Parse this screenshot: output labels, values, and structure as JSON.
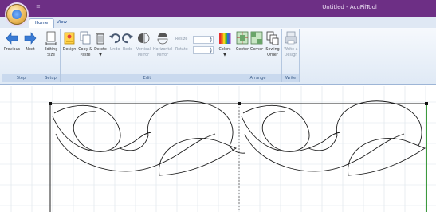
{
  "window": {
    "title": "Untitled - AcuFilTool"
  },
  "tabs": [
    {
      "label": "Home"
    },
    {
      "label": "View"
    }
  ],
  "ribbon": {
    "groups": [
      {
        "label": "Step"
      },
      {
        "label": "Setup"
      },
      {
        "label": "Edit"
      },
      {
        "label": "Arrange"
      },
      {
        "label": "Write"
      }
    ],
    "buttons": {
      "previous": [
        "Previous"
      ],
      "next": [
        "Next"
      ],
      "editing_size": [
        "Editing",
        "Size"
      ],
      "design": [
        "Design"
      ],
      "copy_paste": [
        "Copy &",
        "Paste"
      ],
      "delete": [
        "Delete",
        "▼"
      ],
      "undo": [
        "Undo"
      ],
      "redo": [
        "Redo"
      ],
      "vertical_mirror": [
        "Vertical",
        "Mirror"
      ],
      "horizontal_mirror": [
        "Horizontal",
        "Mirror"
      ],
      "colors": [
        "Colors",
        "▼"
      ],
      "center": [
        "Center"
      ],
      "corner": [
        "Corner"
      ],
      "sewing_order": [
        "Sewing",
        "Order"
      ],
      "write_a_design": [
        "Write a",
        "Design"
      ]
    },
    "resize_label": "Resize",
    "rotate_label": "Rotate"
  },
  "icons": {
    "app": "app-orb-icon",
    "previous": "arrow-left-icon",
    "next": "arrow-right-icon",
    "editing_size": "page-size-icon",
    "design": "design-icon",
    "copy_paste": "copy-icon",
    "delete": "trash-icon",
    "undo": "undo-icon",
    "redo": "redo-icon",
    "vertical_mirror": "mirror-vertical-icon",
    "horizontal_mirror": "mirror-horizontal-icon",
    "colors": "color-palette-icon",
    "center": "center-icon",
    "corner": "corner-icon",
    "sewing_order": "sewing-order-icon",
    "write_a_design": "write-design-icon"
  },
  "colors": {
    "titlebar": "#6d2f85",
    "ribbon": "#dfe9f5",
    "accent": "#15428b"
  }
}
